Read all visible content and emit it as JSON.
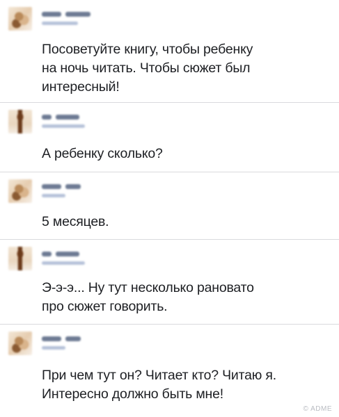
{
  "posts": [
    {
      "avatar": "user-a-avatar",
      "text": "Посоветуйте книгу, чтобы ребенку\nна ночь читать. Чтобы сюжет был\nинтересный!"
    },
    {
      "avatar": "user-b-avatar",
      "text": "А ребенку сколько?"
    },
    {
      "avatar": "user-a-avatar",
      "text": "5 месяцев."
    },
    {
      "avatar": "user-b-avatar",
      "text": "Э-э-э... Ну тут несколько рановато\nпро сюжет говорить."
    },
    {
      "avatar": "user-a-avatar",
      "text": "При чем тут он? Читает кто? Читаю я.\nИнтересно должно быть мне!"
    }
  ],
  "watermark": "© ADME"
}
